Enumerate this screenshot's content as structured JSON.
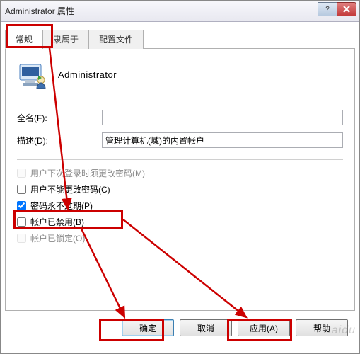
{
  "window": {
    "title": "Administrator 属性"
  },
  "tabs": {
    "general": "常规",
    "memberof": "隶属于",
    "profile": "配置文件"
  },
  "user": {
    "name": "Administrator"
  },
  "form": {
    "fullname_label": "全名(F):",
    "fullname_value": "",
    "description_label": "描述(D):",
    "description_value": "管理计算机(域)的内置帐户"
  },
  "checks": {
    "must_change": "用户下次登录时须更改密码(M)",
    "cannot_change": "用户不能更改密码(C)",
    "never_expire": "密码永不过期(P)",
    "disabled": "帐户已禁用(B)",
    "locked": "帐户已锁定(O)"
  },
  "buttons": {
    "ok": "确定",
    "cancel": "取消",
    "apply": "应用(A)",
    "help": "帮助"
  },
  "watermark": "Baidu"
}
